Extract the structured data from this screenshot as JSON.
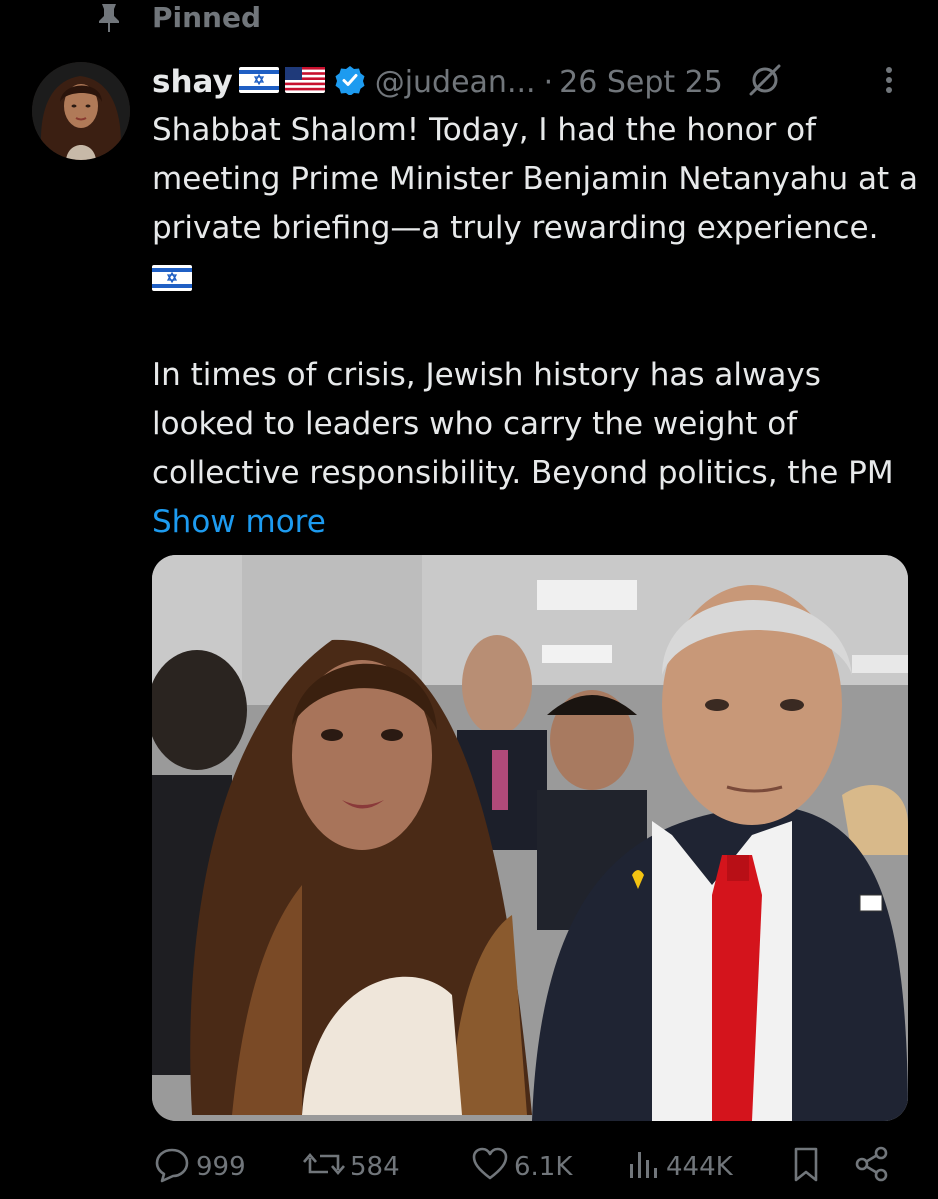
{
  "pinned": {
    "label": "Pinned"
  },
  "author": {
    "name": "shay",
    "handle": "@judean...",
    "separator": "·",
    "date": "26 Sept 25"
  },
  "tweet": {
    "paragraph1": "Shabbat Shalom! Today, I had the honor of meeting Prime Minister Benjamin Netanyahu at a private briefing—a truly rewarding experience.",
    "paragraph2": "In times of crisis, Jewish history has always looked to leaders who carry the weight of collective responsibility. Beyond politics, the PM",
    "show_more": "Show more"
  },
  "metrics": {
    "replies": "999",
    "reposts": "584",
    "likes": "6.1K",
    "views": "444K"
  },
  "icons": [
    "pin-icon",
    "avatar",
    "israel-flag-icon",
    "us-flag-icon",
    "verified-badge-icon",
    "grok-icon",
    "more-icon",
    "reply-icon",
    "repost-icon",
    "like-icon",
    "views-icon",
    "bookmark-icon",
    "share-icon"
  ],
  "colors": {
    "background": "#000000",
    "text": "#e7e9ea",
    "secondary": "#71767b",
    "link": "#1d9bf0",
    "verified": "#1d9bf0"
  }
}
